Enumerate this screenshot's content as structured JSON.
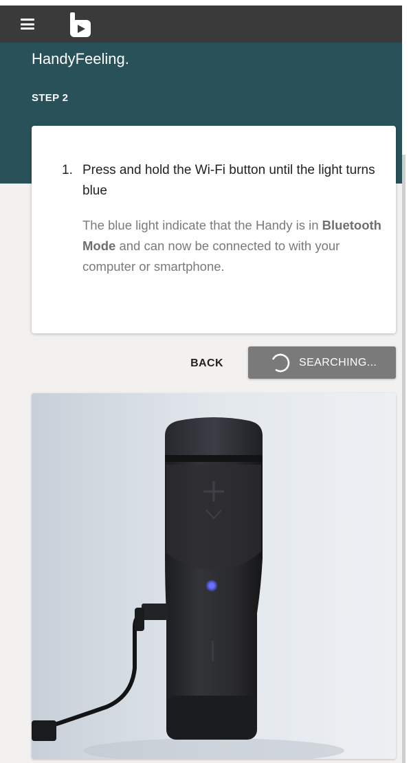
{
  "header": {
    "menu_icon": "hamburger-menu-icon",
    "logo_icon": "handy-logo-icon"
  },
  "hero": {
    "text": "HandyFeeling.",
    "step_label": "STEP 2"
  },
  "instruction_card": {
    "number": "1.",
    "title": "Press and hold the Wi-Fi button until the light turns blue",
    "body_prefix": "The blue light indicate that the Handy is in ",
    "body_bold": "Bluetooth Mode",
    "body_suffix": " and can now be connected to with your computer or smartphone."
  },
  "actions": {
    "back_label": "BACK",
    "search_label": "SEARCHING...",
    "spinner_icon": "loading-spinner-icon"
  },
  "colors": {
    "topbar": "#3a3a3a",
    "hero": "#295159",
    "page_background": "#f3f1ef",
    "search_button": "#7a7a7a",
    "led": "#5a63ff"
  },
  "photo": {
    "subject": "handy-device-photo"
  }
}
